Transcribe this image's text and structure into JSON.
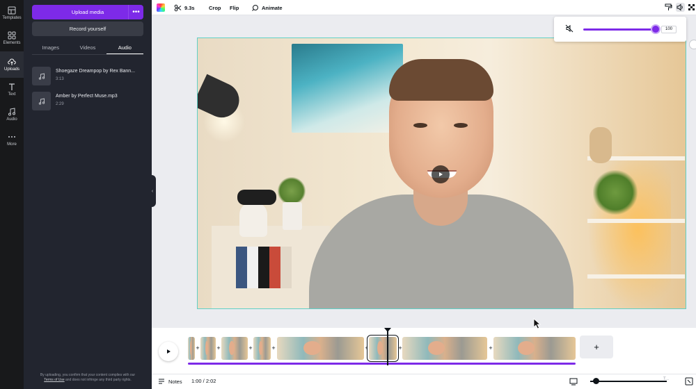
{
  "rail": {
    "items": [
      {
        "label": "Templates",
        "icon": "templates-icon"
      },
      {
        "label": "Elements",
        "icon": "elements-icon"
      },
      {
        "label": "Uploads",
        "icon": "upload-cloud-icon",
        "active": true
      },
      {
        "label": "Text",
        "icon": "text-icon"
      },
      {
        "label": "Audio",
        "icon": "music-note-icon"
      },
      {
        "label": "More",
        "icon": "more-dots-icon"
      }
    ]
  },
  "panel": {
    "upload_label": "Upload media",
    "more_label": "•••",
    "record_label": "Record yourself",
    "tabs": [
      "Images",
      "Videos",
      "Audio"
    ],
    "active_tab": "Audio",
    "audio_items": [
      {
        "name": "Shoegaze Dreampop by Rex Bann...",
        "duration": "3:13"
      },
      {
        "name": "Amber by Perfect Muse.mp3",
        "duration": "2:29"
      }
    ],
    "terms_prefix": "By uploading, you confirm that your content complies with our",
    "terms_link": "Terms of Use",
    "terms_suffix": "and does not infringe any third party rights."
  },
  "toolbar": {
    "duration_label": "9.3s",
    "crop_label": "Crop",
    "flip_label": "Flip",
    "animate_label": "Animate"
  },
  "volume": {
    "value": "100",
    "level": 1.0
  },
  "footer": {
    "notes_label": "Notes",
    "time_label": "1:00 / 2:02",
    "zoom_label": "T..."
  },
  "colors": {
    "accent": "#7d2ae8",
    "rail_bg": "#18191b",
    "panel_bg": "#22252f",
    "selection": "#5fd0c6"
  }
}
